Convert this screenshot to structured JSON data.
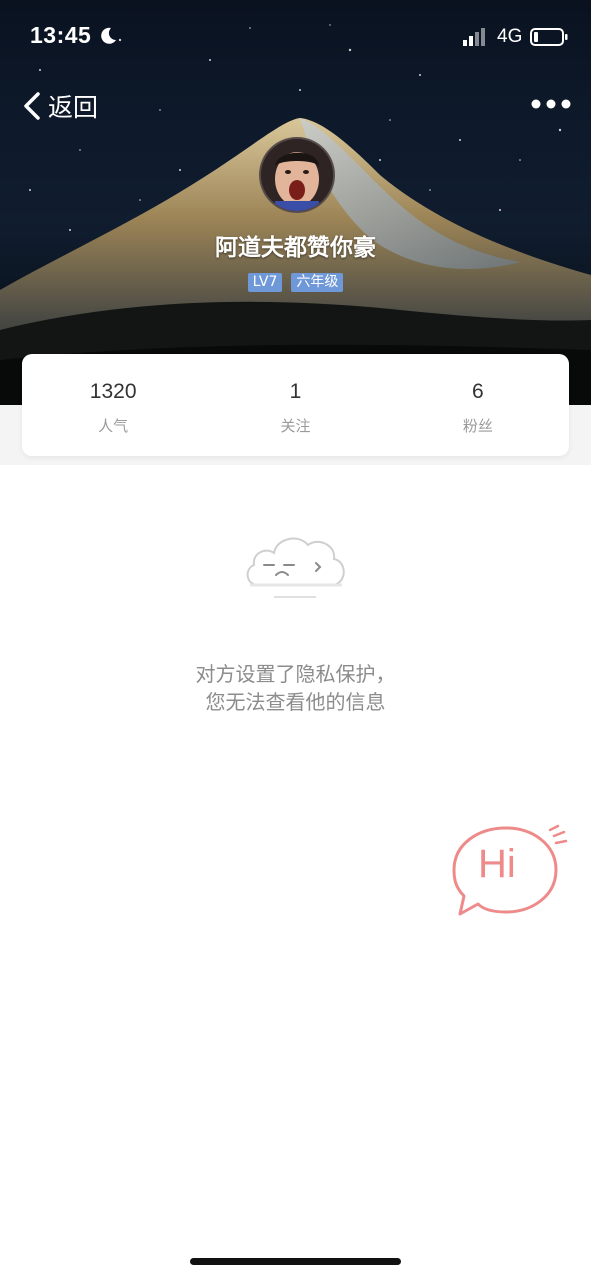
{
  "status_bar": {
    "time": "13:45",
    "network": "4G",
    "icons": [
      "moon-icon",
      "signal-icon",
      "battery-icon"
    ]
  },
  "nav": {
    "back_label": "返回",
    "back_icon": "chevron-left-icon",
    "more_icon": "more-dots-icon"
  },
  "profile": {
    "name": "阿道夫都赞你豪",
    "level_badge": "LV7",
    "grade_badge": "六年级",
    "badge_color": "#6f98d8"
  },
  "stats": [
    {
      "value": "1320",
      "label": "人气"
    },
    {
      "value": "1",
      "label": "关注"
    },
    {
      "value": "6",
      "label": "粉丝"
    }
  ],
  "empty_state": {
    "line1": "对方设置了隐私保护，",
    "line2": "您无法查看他的信息",
    "icon": "cloud-face-icon"
  },
  "hi_button": {
    "label": "Hi",
    "color": "#ee8a8a"
  }
}
